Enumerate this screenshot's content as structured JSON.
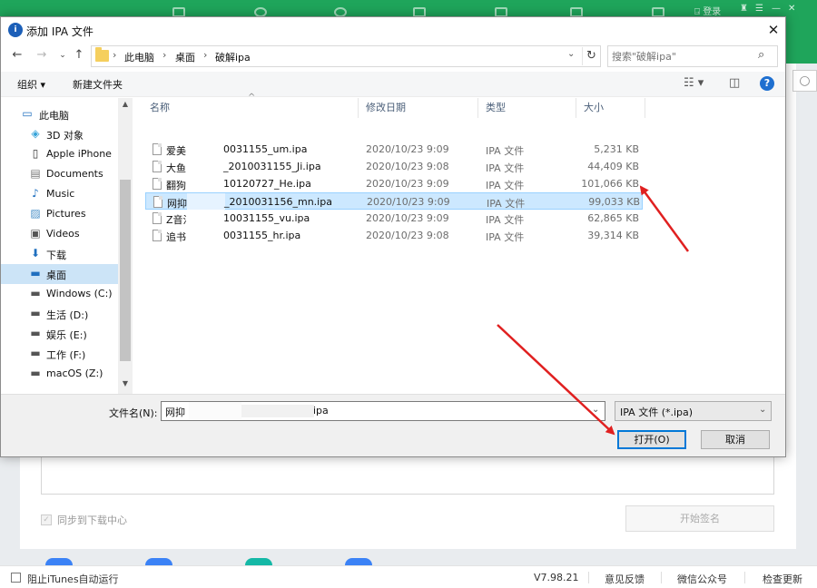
{
  "background": {
    "top_buttons": [
      "登录"
    ],
    "sync_label": "同步到下载中心",
    "sign_button": "开始签名",
    "status": {
      "block_itunes": "阻止iTunes自动运行",
      "version": "V7.98.21",
      "feedback": "意见反馈",
      "wechat": "微信公众号",
      "check_update": "检查更新"
    }
  },
  "dialog": {
    "title": "添加 IPA 文件",
    "breadcrumb": [
      "此电脑",
      "桌面",
      "破解ipa"
    ],
    "search_placeholder": "搜索\"破解ipa\"",
    "toolbar": {
      "organize": "组织 ▾",
      "new_folder": "新建文件夹"
    },
    "nav_items": [
      {
        "label": "此电脑",
        "icon": "computer-icon"
      },
      {
        "label": "3D 对象",
        "icon": "cube-icon"
      },
      {
        "label": "Apple iPhone",
        "icon": "phone-icon"
      },
      {
        "label": "Documents",
        "icon": "document-icon"
      },
      {
        "label": "Music",
        "icon": "music-icon"
      },
      {
        "label": "Pictures",
        "icon": "picture-icon"
      },
      {
        "label": "Videos",
        "icon": "video-icon"
      },
      {
        "label": "下载",
        "icon": "download-icon"
      },
      {
        "label": "桌面",
        "icon": "desktop-icon",
        "selected": true
      },
      {
        "label": "Windows (C:)",
        "icon": "drive-icon"
      },
      {
        "label": "生活 (D:)",
        "icon": "drive-icon"
      },
      {
        "label": "娱乐 (E:)",
        "icon": "drive-icon"
      },
      {
        "label": "工作 (F:)",
        "icon": "drive-icon"
      },
      {
        "label": "macOS (Z:)",
        "icon": "drive-icon"
      }
    ],
    "columns": [
      "名称",
      "修改日期",
      "类型",
      "大小"
    ],
    "files": [
      {
        "name_a": "爱美",
        "name_b": "0031155_um.ipa",
        "date": "2020/10/23 9:09",
        "type": "IPA 文件",
        "size": "5,231 KB"
      },
      {
        "name_a": "大鱼",
        "name_b": "_2010031155_Ji.ipa",
        "date": "2020/10/23 9:08",
        "type": "IPA 文件",
        "size": "44,409 KB"
      },
      {
        "name_a": "翻狗",
        "name_b": "10120727_He.ipa",
        "date": "2020/10/23 9:09",
        "type": "IPA 文件",
        "size": "101,066 KB"
      },
      {
        "name_a": "网抑",
        "name_b": "_2010031156_mn.ipa",
        "date": "2020/10/23 9:09",
        "type": "IPA 文件",
        "size": "99,033 KB",
        "selected": true
      },
      {
        "name_a": "Z音泛",
        "name_b": "10031155_vu.ipa",
        "date": "2020/10/23 9:09",
        "type": "IPA 文件",
        "size": "62,865 KB"
      },
      {
        "name_a": "追书",
        "name_b": "0031155_hr.ipa",
        "date": "2020/10/23 9:08",
        "type": "IPA 文件",
        "size": "39,314 KB"
      }
    ],
    "filename_label": "文件名(N):",
    "filename_value_a": "网抑",
    "filename_value_b": "ipa",
    "filetype": "IPA 文件 (*.ipa)",
    "open_button": "打开(O)",
    "cancel_button": "取消"
  },
  "colors": {
    "app_green": "#1fa55b",
    "selection": "#cce8ff",
    "arrow": "#e02020",
    "default_button_border": "#0078d7"
  }
}
